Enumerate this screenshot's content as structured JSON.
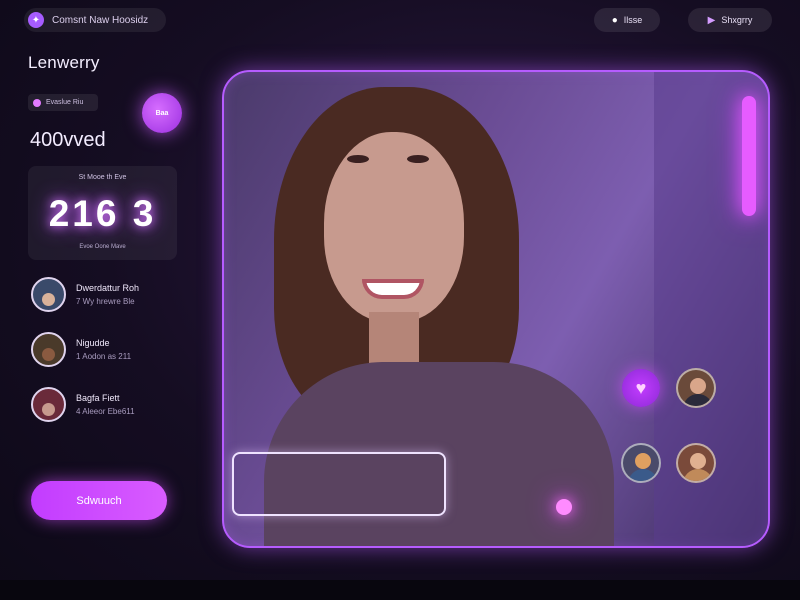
{
  "app": {
    "title": "Comsnt Naw Hoosidz"
  },
  "header": {
    "live_label": "Ilsse",
    "share_label": "Shxgrry"
  },
  "sidebar": {
    "brand": "Lenwerry",
    "tag_label": "Evaslue Riu",
    "chat_badge": "Baa",
    "followers": "400vved",
    "stat": {
      "label_top": "St Mooe th Eve",
      "value": "216 3",
      "label_bottom": "Evoe Oone Mave"
    },
    "users": [
      {
        "name": "Dwerdattur Roh",
        "sub": "7 Wy hrewre Ble"
      },
      {
        "name": "Nigudde",
        "sub": "1 Aodon as 211"
      },
      {
        "name": "Bagfa Fiett",
        "sub": "4 Aleeor Ebe611"
      }
    ],
    "cta_label": "Sdwuuch"
  },
  "colors": {
    "accent": "#c23cff",
    "glow": "#e65cff",
    "background": "#150d22"
  },
  "icons": {
    "app": "app-logo-icon",
    "live": "live-toggle-icon",
    "share": "play-icon",
    "heart": "heart-icon"
  }
}
